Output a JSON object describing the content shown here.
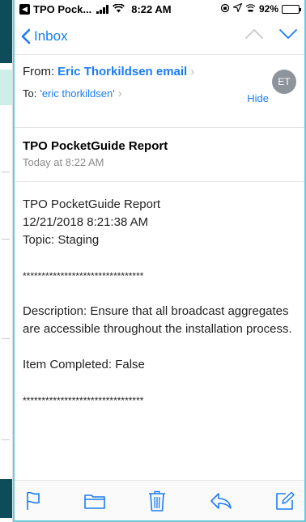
{
  "status_bar": {
    "carrier": "TPO Pock...",
    "time": "8:22 AM",
    "battery": "92%",
    "battery_level": 0.92
  },
  "nav": {
    "back_label": "Inbox",
    "icons": [
      "chevron-left-icon",
      "chevron-up-icon",
      "chevron-down-icon"
    ]
  },
  "header": {
    "from_label": "From:",
    "from_name": "Eric Thorkildsen email",
    "to_label": "To:",
    "to_name": "'eric thorkildsen'",
    "hide_label": "Hide",
    "avatar_initials": "ET",
    "avatar_color": "#8e949b"
  },
  "message": {
    "subject": "TPO PocketGuide Report",
    "date": "Today at 8:22 AM",
    "body": {
      "title": "TPO PocketGuide Report",
      "timestamp": "12/21/2018 8:21:38 AM",
      "topic": "Topic: Staging",
      "separator_1": "********************************",
      "description": "Description: Ensure that all broadcast aggregates are accessible throughout the installation process.",
      "item_completed": "Item Completed: False",
      "separator_2": "********************************"
    }
  },
  "toolbar": {
    "icons": [
      "flag-icon",
      "folder-icon",
      "trash-icon",
      "reply-icon",
      "compose-icon"
    ]
  },
  "colors": {
    "accent": "#1a7cf5",
    "screen_border": "#6ec9d5",
    "background_app": "#0f4c59"
  }
}
